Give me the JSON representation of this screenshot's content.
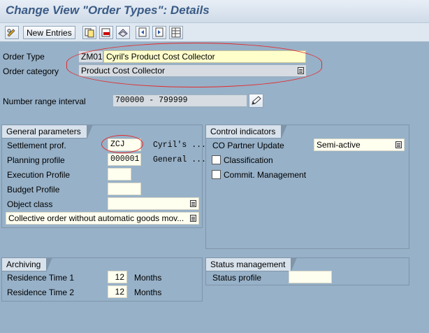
{
  "header": {
    "title": "Change View \"Order Types\": Details"
  },
  "toolbar": {
    "new_entries_label": "New Entries"
  },
  "order_type": {
    "label": "Order Type",
    "code": "ZM01",
    "description": "Cyril's Product Cost Collector"
  },
  "order_category": {
    "label": "Order category",
    "value": "Product Cost Collector"
  },
  "number_range": {
    "label": "Number range interval",
    "value": "700000 - 799999"
  },
  "general_parameters": {
    "title": "General parameters",
    "settlement_prof": {
      "label": "Settlement prof.",
      "value": "ZCJ",
      "description": "Cyril's ..."
    },
    "planning_profile": {
      "label": "Planning profile",
      "value": "000001",
      "description": "General ..."
    },
    "execution_profile": {
      "label": "Execution Profile",
      "value": ""
    },
    "budget_profile": {
      "label": "Budget Profile",
      "value": ""
    },
    "object_class": {
      "label": "Object class",
      "value": ""
    },
    "order_type_option": {
      "value": "Collective order without automatic goods mov..."
    }
  },
  "control_indicators": {
    "title": "Control indicators",
    "co_partner_update": {
      "label": "CO Partner Update",
      "value": "Semi-active"
    },
    "classification": {
      "label": "Classification",
      "checked": false
    },
    "commit_management": {
      "label": "Commit. Management",
      "checked": false
    }
  },
  "archiving": {
    "title": "Archiving",
    "residence_time_1": {
      "label": "Residence Time 1",
      "value": "12",
      "unit": "Months"
    },
    "residence_time_2": {
      "label": "Residence Time 2",
      "value": "12",
      "unit": "Months"
    }
  },
  "status_management": {
    "title": "Status management",
    "status_profile": {
      "label": "Status profile",
      "value": ""
    }
  }
}
